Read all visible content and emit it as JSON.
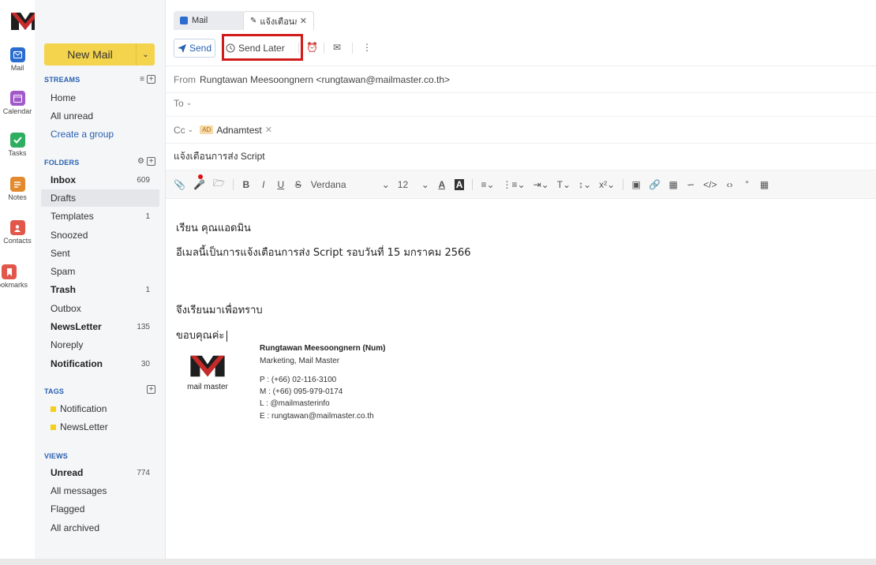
{
  "logo": {
    "line1": "mail",
    "line2": "master"
  },
  "rail": [
    {
      "label": "Mail",
      "color": "#2b6cd0",
      "icon": "mail-icon"
    },
    {
      "label": "Calendar",
      "color": "#a158c9",
      "icon": "calendar-icon"
    },
    {
      "label": "Tasks",
      "color": "#2fae62",
      "icon": "tasks-icon"
    },
    {
      "label": "Notes",
      "color": "#e38a2e",
      "icon": "notes-icon"
    },
    {
      "label": "Contacts",
      "color": "#e2574c",
      "icon": "contacts-icon"
    },
    {
      "label": "Bookmarks",
      "color": "#e2574c",
      "icon": "bookmarks-icon"
    }
  ],
  "sidebar": {
    "new_mail": "New Mail",
    "streams": {
      "title": "STREAMS",
      "items": [
        {
          "label": "Home"
        },
        {
          "label": "All unread"
        },
        {
          "label": "Create a group"
        }
      ]
    },
    "folders": {
      "title": "FOLDERS",
      "items": [
        {
          "label": "Inbox",
          "count": "609"
        },
        {
          "label": "Drafts",
          "count": ""
        },
        {
          "label": "Templates",
          "count": "1"
        },
        {
          "label": "Snoozed",
          "count": ""
        },
        {
          "label": "Sent",
          "count": ""
        },
        {
          "label": "Spam",
          "count": ""
        },
        {
          "label": "Trash",
          "count": "1"
        },
        {
          "label": "Outbox",
          "count": ""
        },
        {
          "label": "NewsLetter",
          "count": "135"
        },
        {
          "label": "Noreply",
          "count": ""
        },
        {
          "label": "Notification",
          "count": "30"
        }
      ]
    },
    "tags": {
      "title": "TAGS",
      "tag_color": "#f5cf1a",
      "items": [
        {
          "label": "Notification"
        },
        {
          "label": "NewsLetter"
        }
      ]
    },
    "views": {
      "title": "VIEWS",
      "items": [
        {
          "label": "Unread",
          "count": "774"
        },
        {
          "label": "All messages",
          "count": ""
        },
        {
          "label": "Flagged",
          "count": ""
        },
        {
          "label": "All archived",
          "count": ""
        }
      ]
    }
  },
  "tabs": [
    {
      "label": "Mail"
    },
    {
      "label": "แจ้งเตือนก"
    }
  ],
  "toolbar": {
    "send": "Send",
    "send_later": "Send Later"
  },
  "fields": {
    "from_label": "From",
    "from_value": "Rungtawan Meesoongnern <rungtawan@mailmaster.co.th>",
    "to_label": "To",
    "cc_label": "Cc",
    "cc_chip_initials": "AD",
    "cc_chip_name": "Adnamtest",
    "subject": "แจ้งเตือนการส่ง Script"
  },
  "editor": {
    "font": "Verdana",
    "size": "12"
  },
  "body": {
    "greeting": "เรียน คุณแอดมิน",
    "line1": "อีเมลนี้เป็นการแจ้งเตือนการส่ง Script รอบวันที่ 15 มกราคม 2566",
    "closing": "จึงเรียนมาเพื่อทราบ",
    "thanks": "ขอบคุณค่ะ"
  },
  "signature": {
    "logo_text": "mail master",
    "name": "Rungtawan Meesoongnern (Num)",
    "title": "Marketing, Mail Master",
    "phone": "P : (+66) 02-116-3100",
    "mobile": "M : (+66) 095-979-0174",
    "line": "L : @mailmasterinfo",
    "email": "E : rungtawan@mailmaster.co.th"
  }
}
